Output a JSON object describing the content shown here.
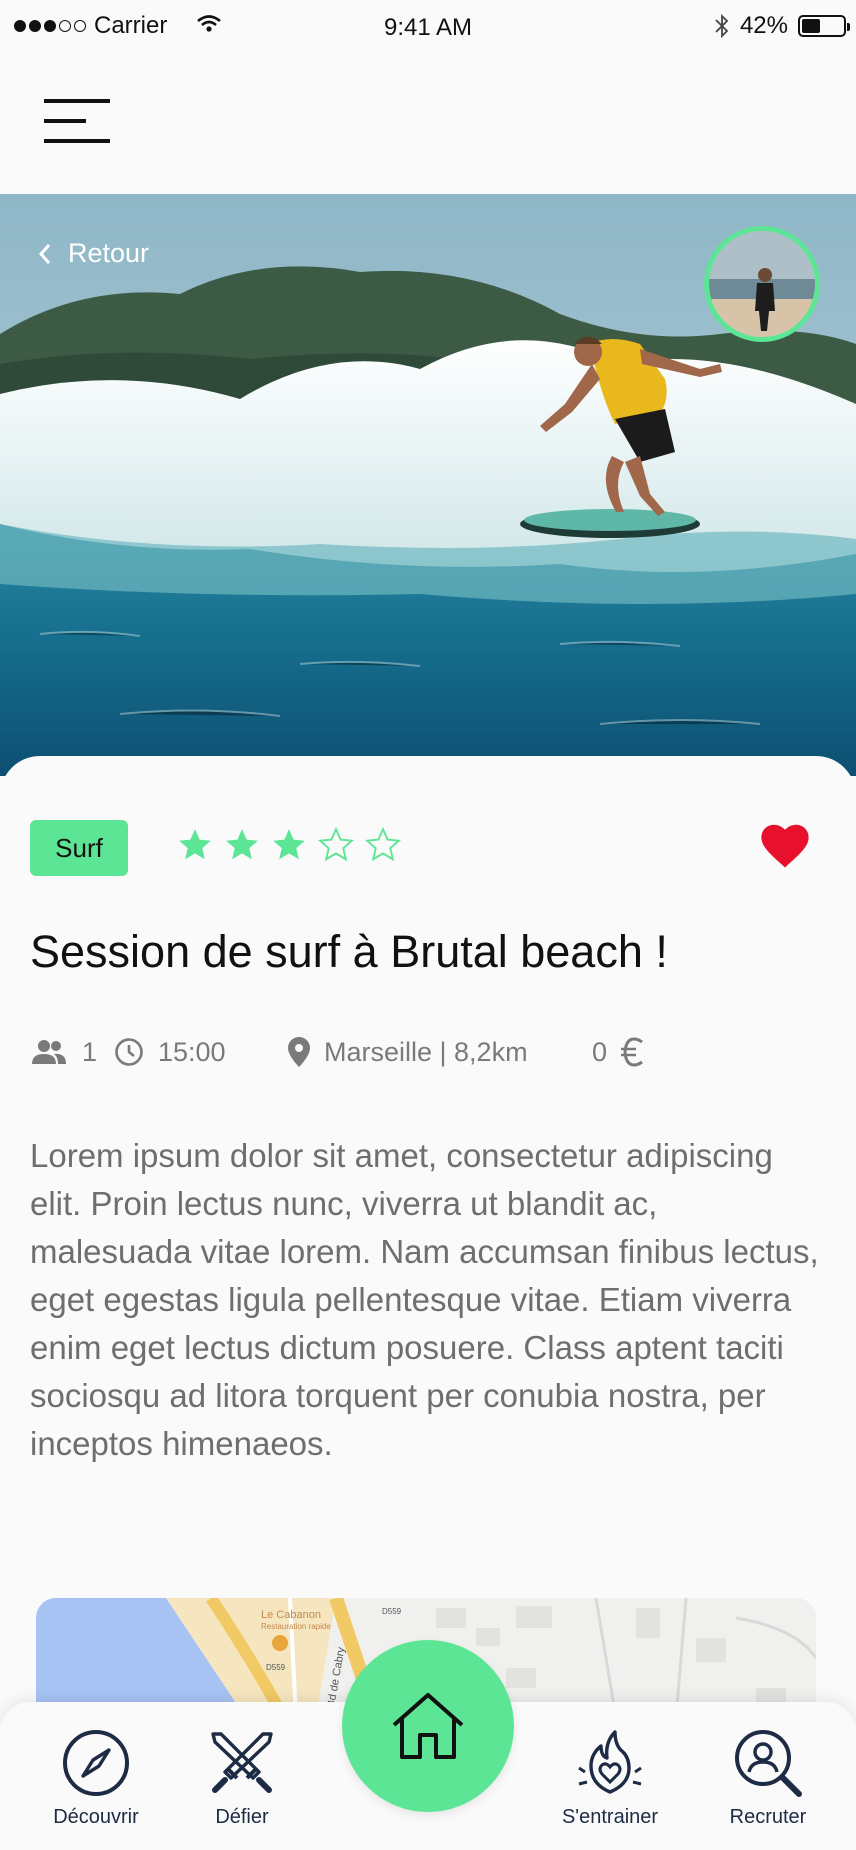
{
  "status_bar": {
    "carrier": "Carrier",
    "time": "9:41 AM",
    "battery": "42%",
    "battery_level": 0.42,
    "signal_bars": 3
  },
  "header": {
    "menu_icon": "hamburger-menu-icon"
  },
  "hero": {
    "back_label": "Retour",
    "back_icon": "chevron-left-icon"
  },
  "event": {
    "category": "Surf",
    "rating": 3,
    "rating_max": 5,
    "favorite": true,
    "title": "Session de surf à Brutal beach !",
    "participants": "1",
    "time": "15:00",
    "location": "Marseille | 8,2km",
    "price": "0",
    "currency_icon": "euro-icon",
    "description": "Lorem ipsum dolor sit amet, consectetur adipiscing elit. Proin lectus nunc, viverra ut blandit ac, malesuada vitae lorem. Nam accumsan finibus lectus, eget egestas ligula pellentesque vitae. Etiam viverra enim eget lectus dictum posuere. Class aptent taciti sociosqu ad litora torquent per conubia nostra, per inceptos himenaeos."
  },
  "map": {
    "poi_name": "Le Cabanon",
    "poi_sub": "Restauration rapide",
    "road_1": "D559",
    "road_2": "D559",
    "street": "Bd de Cabry"
  },
  "bottom_nav": {
    "items": [
      {
        "label": "Découvrir",
        "icon": "compass-icon"
      },
      {
        "label": "Défier",
        "icon": "crossed-swords-icon"
      },
      {
        "label": "S'entrainer",
        "icon": "flame-heart-icon"
      },
      {
        "label": "Recruter",
        "icon": "search-user-icon"
      }
    ],
    "home_icon": "home-icon"
  },
  "colors": {
    "accent": "#5ce595",
    "heart": "#e8112d",
    "nav_text": "#1d2b44",
    "muted_text": "#6e6e6e"
  }
}
